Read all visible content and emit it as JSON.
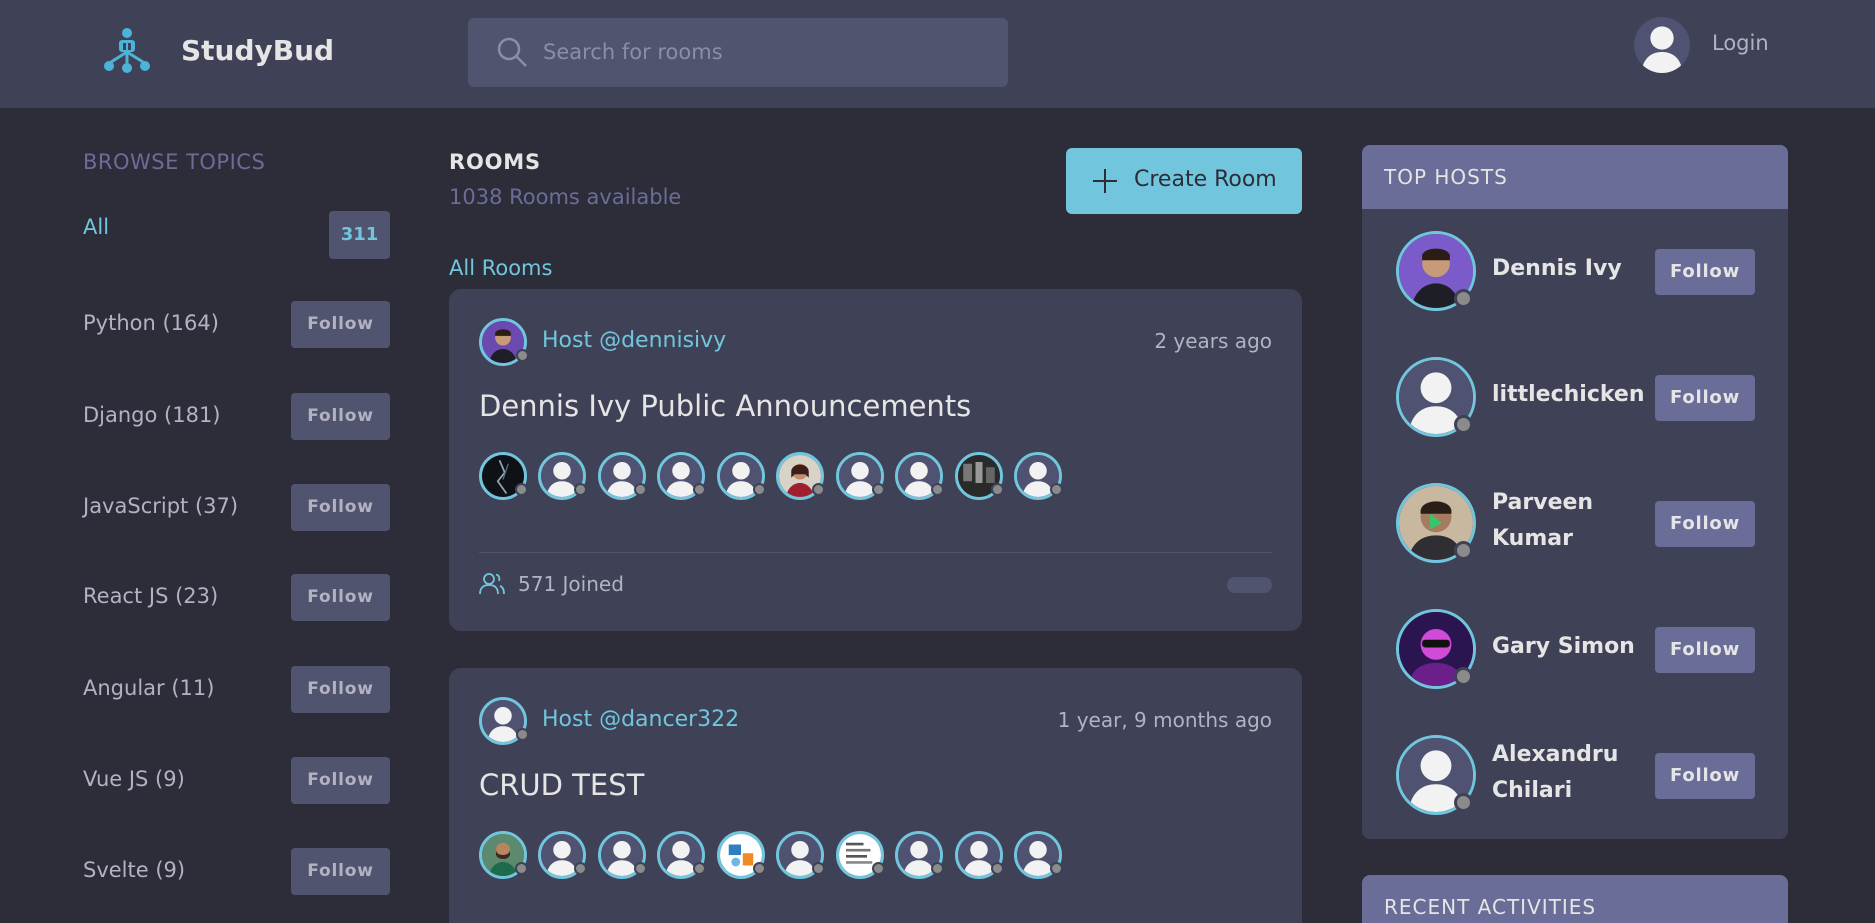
{
  "header": {
    "brand": "StudyBud",
    "search_placeholder": "Search for rooms",
    "login": "Login"
  },
  "topics": {
    "heading": "BROWSE TOPICS",
    "all_label": "All",
    "all_count": "311",
    "follow_label": "Follow",
    "items": [
      "Python (164)",
      "Django (181)",
      "JavaScript (37)",
      "React JS (23)",
      "Angular (11)",
      "Vue JS (9)",
      "Svelte (9)"
    ]
  },
  "rooms": {
    "title": "ROOMS",
    "count": "1038 Rooms available",
    "create_label": "Create Room",
    "filter_label": "All Rooms",
    "cards": [
      {
        "host": "Host @dennisivy",
        "time": "2 years ago",
        "title": "Dennis Ivy Public Announcements",
        "joined": "571 Joined"
      },
      {
        "host": "Host @dancer322",
        "time": "1 year, 9 months ago",
        "title": "CRUD TEST"
      }
    ]
  },
  "top_hosts": {
    "heading": "TOP HOSTS",
    "follow_label": "Follow",
    "hosts": [
      {
        "name": "Dennis Ivy"
      },
      {
        "name": "littlechicken"
      },
      {
        "name": "Parveen Kumar"
      },
      {
        "name": "Gary Simon"
      },
      {
        "name": "Alexandru Chilari"
      }
    ]
  },
  "recent": {
    "heading": "RECENT ACTIVITIES"
  },
  "colors": {
    "background": "#2d2d39",
    "header": "#3f4156",
    "accent": "#71c6dd",
    "muted_purple": "#696d97",
    "card": "#3f4156"
  }
}
